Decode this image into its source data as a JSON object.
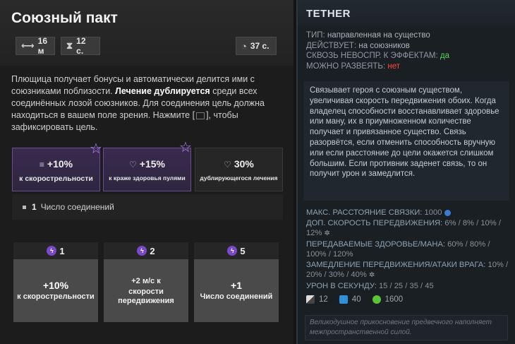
{
  "ability": {
    "title": "Союзный пакт",
    "range": "16 м",
    "duration": "12 с.",
    "cooldown": "37 с.",
    "description_1": "Плющица получает бонусы и автоматически делится ими с союзниками поблизости. ",
    "description_bold": "Лечение дублируется",
    "description_2": " среди всех соединённых лозой союзников. Для соединения цель должна находиться в вашем поле зрения. Нажмите [",
    "description_3": "], чтобы зафиксировать цель.",
    "bonuses": [
      {
        "value": "+10%",
        "label": "к скорострельности"
      },
      {
        "value": "+15%",
        "label": "к краже здоровья пулями"
      },
      {
        "value": "30%",
        "label": "дублирующегося лечения"
      }
    ],
    "connections_count": "1",
    "connections_label": "Число соединений",
    "tiers": [
      {
        "tier": "1",
        "value": "+10%",
        "text": "к скорострельности"
      },
      {
        "tier": "2",
        "value": "+2 м/с к",
        "text": "скорости передвижения"
      },
      {
        "tier": "5",
        "value": "+1",
        "text": "Число соединений"
      }
    ]
  },
  "tooltip": {
    "title": "TETHER",
    "type_label": "ТИП:",
    "type_value": "направленная на существо",
    "acts_label": "ДЕЙСТВУЕТ:",
    "acts_value": "на союзников",
    "pierce_label": "СКВОЗЬ НЕВОСПР. К ЭФФЕКТАМ:",
    "pierce_value": "да",
    "dispel_label": "МОЖНО РАЗВЕЯТЬ:",
    "dispel_value": "нет",
    "description": "Связывает героя с союзным существом, увеличивая скорость передвижения обоих. Когда владелец способности восстанавливает здоровье или ману, их в приумноженном количестве получает и привязанное существо. Связь разорвётся, если отменить способность вручную или если расстояние до цели окажется слишком большим. Если противник заденет связь, то он получит урон и замедлится.",
    "attrs": [
      {
        "key": "МАКС. РАССТОЯНИЕ СВЯЗКИ:",
        "value": "1000"
      },
      {
        "key": "ДОП. СКОРОСТЬ ПЕРЕДВИЖЕНИЯ:",
        "value": "6% / 8% / 10% / 12%"
      },
      {
        "key": "ПЕРЕДАВАЕМЫЕ ЗДОРОВЬЕ/МАНА:",
        "value": "60% / 80% / 100% / 120%"
      },
      {
        "key": "ЗАМЕДЛЕНИЕ ПЕРЕДВИЖЕНИЯ/АТАКИ ВРАГА:",
        "value": "10% / 20% / 30% / 40%"
      },
      {
        "key": "УРОН В СЕКУНДУ:",
        "value": "15 / 25 / 35 / 45"
      }
    ],
    "costs": [
      "12",
      "40",
      "1600"
    ],
    "lore": "Великодушное прикосновение предвечного наполняет межпространственной силой."
  }
}
